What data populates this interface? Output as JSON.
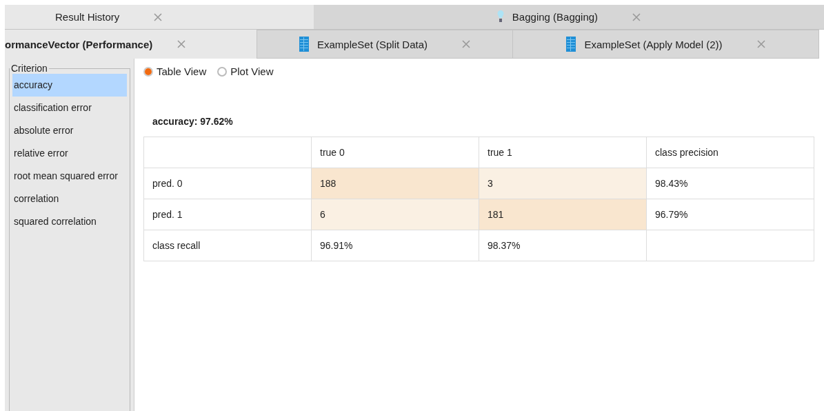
{
  "tab_rows": [
    {
      "tabs": [
        {
          "label": "Result History",
          "kind": "plain",
          "selected": true
        },
        {
          "label": "Bagging (Bagging)",
          "kind": "model",
          "selected": false
        }
      ]
    },
    {
      "tabs": [
        {
          "label": "ormanceVector (Performance)",
          "kind": "plain",
          "selected": true
        },
        {
          "label": "ExampleSet (Split Data)",
          "kind": "data",
          "selected": false
        },
        {
          "label": "ExampleSet (Apply Model (2))",
          "kind": "data",
          "selected": false
        }
      ]
    }
  ],
  "criterion": {
    "title": "Criterion",
    "items": [
      {
        "label": "accuracy",
        "selected": true
      },
      {
        "label": "classification error",
        "selected": false
      },
      {
        "label": "absolute error",
        "selected": false
      },
      {
        "label": "relative error",
        "selected": false
      },
      {
        "label": "root mean squared error",
        "selected": false
      },
      {
        "label": "correlation",
        "selected": false
      },
      {
        "label": "squared correlation",
        "selected": false
      }
    ]
  },
  "view_options": [
    {
      "label": "Table View",
      "selected": true
    },
    {
      "label": "Plot View",
      "selected": false
    }
  ],
  "result_title": "accuracy: 97.62%",
  "table": {
    "columns": [
      "",
      "true 0",
      "true 1",
      "class precision"
    ],
    "rows": [
      [
        {
          "text": "pred. 0"
        },
        {
          "text": "188",
          "color": "#f9e6cf"
        },
        {
          "text": "3",
          "color": "#faf0e3"
        },
        {
          "text": "98.43%"
        }
      ],
      [
        {
          "text": "pred. 1"
        },
        {
          "text": "6",
          "color": "#faf0e3"
        },
        {
          "text": "181",
          "color": "#f9e6cf"
        },
        {
          "text": "96.79%"
        }
      ],
      [
        {
          "text": "class recall"
        },
        {
          "text": "96.91%"
        },
        {
          "text": "98.37%"
        },
        {
          "text": ""
        }
      ]
    ]
  }
}
